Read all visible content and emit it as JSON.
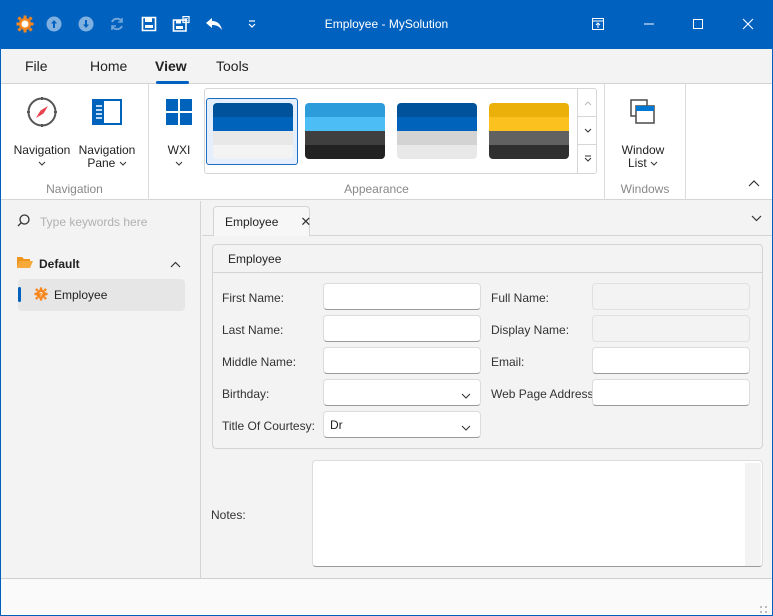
{
  "window": {
    "title": "Employee - MySolution",
    "quick_access": [
      "app-gear-icon",
      "previous-record-icon",
      "next-record-icon",
      "refresh-icon",
      "save-icon",
      "save-and-close-icon",
      "undo-icon",
      "customize-quick-access-icon"
    ],
    "controls": [
      "restore-tab-icon",
      "minimize-icon",
      "maximize-icon",
      "close-icon"
    ]
  },
  "menu": {
    "tabs": [
      {
        "label": "File"
      },
      {
        "label": "Home"
      },
      {
        "label": "View",
        "active": true
      },
      {
        "label": "Tools"
      }
    ]
  },
  "ribbon": {
    "groups": {
      "navigation": {
        "label": "Navigation",
        "buttons": [
          {
            "label_line1": "Navigation",
            "label_line2": "",
            "icon": "compass-icon"
          },
          {
            "label_line1": "Navigation",
            "label_line2": "Pane",
            "icon": "navigation-pane-icon"
          }
        ]
      },
      "appearance": {
        "label": "Appearance",
        "skin_button": {
          "label": "WXI",
          "icon": "windows-logo-icon"
        },
        "skins": [
          {
            "name": "skin-blue",
            "colors": [
              "#00529a",
              "#0063bb",
              "#e8e8e8",
              "#f3f3f3"
            ],
            "selected": true
          },
          {
            "name": "skin-light-blue-dark",
            "colors": [
              "#2d9cdb",
              "#4dbef5",
              "#3f3f3f",
              "#222222"
            ],
            "selected": false
          },
          {
            "name": "skin-blue-gray",
            "colors": [
              "#00529a",
              "#0063bb",
              "#d3d3d3",
              "#e8e8e8"
            ],
            "selected": false
          },
          {
            "name": "skin-yellow-dark",
            "colors": [
              "#ebb00a",
              "#fbc11f",
              "#616161",
              "#2f2f2f"
            ],
            "selected": false
          }
        ]
      },
      "windows": {
        "label": "Windows",
        "buttons": [
          {
            "label_line1": "Window",
            "label_line2": "List",
            "icon": "window-list-icon"
          }
        ]
      }
    }
  },
  "navigation": {
    "search_placeholder": "Type keywords here",
    "group_label": "Default",
    "items": [
      {
        "label": "Employee",
        "selected": true
      }
    ]
  },
  "document": {
    "tab_label": "Employee",
    "group_title": "Employee",
    "fields_left": [
      {
        "label": "First Name:",
        "value": "",
        "type": "text"
      },
      {
        "label": "Last Name:",
        "value": "",
        "type": "text"
      },
      {
        "label": "Middle Name:",
        "value": "",
        "type": "text"
      },
      {
        "label": "Birthday:",
        "value": "",
        "type": "date"
      },
      {
        "label": "Title Of Courtesy:",
        "value": "Dr",
        "type": "select"
      }
    ],
    "fields_right": [
      {
        "label": "Full Name:",
        "value": "",
        "type": "readonly"
      },
      {
        "label": "Display Name:",
        "value": "",
        "type": "readonly"
      },
      {
        "label": "Email:",
        "value": "",
        "type": "text"
      },
      {
        "label": "Web Page Address:",
        "value": "",
        "type": "text"
      }
    ],
    "notes_label": "Notes:",
    "notes_value": ""
  }
}
